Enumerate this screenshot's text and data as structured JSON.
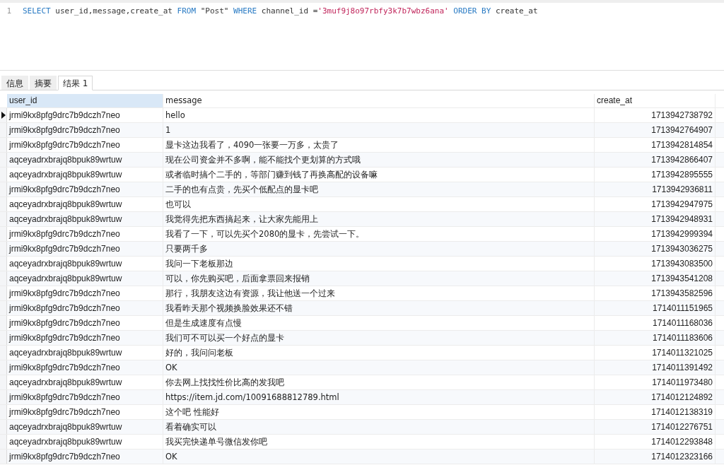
{
  "editor": {
    "line_number": "1",
    "tokens": [
      {
        "kind": "keyword",
        "text": "SELECT"
      },
      {
        "kind": "plain",
        "text": " user_id,message,create_at "
      },
      {
        "kind": "keyword",
        "text": "FROM"
      },
      {
        "kind": "plain",
        "text": " \"Post\" "
      },
      {
        "kind": "keyword",
        "text": "WHERE"
      },
      {
        "kind": "plain",
        "text": " channel_id ="
      },
      {
        "kind": "string",
        "text": "'3muf9j8o97rbfy3k7b7wbz6ana'"
      },
      {
        "kind": "keyword",
        "text": " ORDER BY"
      },
      {
        "kind": "plain",
        "text": " create_at"
      }
    ]
  },
  "tabs": [
    {
      "label": "信息",
      "selected": false
    },
    {
      "label": "摘要",
      "selected": false
    },
    {
      "label": "结果 1",
      "selected": true
    }
  ],
  "table": {
    "columns": [
      {
        "label": "user_id",
        "selected": true
      },
      {
        "label": "message",
        "selected": false
      },
      {
        "label": "create_at",
        "selected": false
      }
    ],
    "rows": [
      {
        "selected": true,
        "cells": [
          "jrmi9kx8pfg9drc7b9dczh7neo",
          "hello",
          "1713942738792"
        ]
      },
      {
        "selected": false,
        "cells": [
          "jrmi9kx8pfg9drc7b9dczh7neo",
          "1",
          "1713942764907"
        ]
      },
      {
        "selected": false,
        "cells": [
          "jrmi9kx8pfg9drc7b9dczh7neo",
          "显卡这边我看了，4090一张要一万多，太贵了",
          "1713942814854"
        ]
      },
      {
        "selected": false,
        "cells": [
          "aqceyadrxbrajq8bpuk89wrtuw",
          "现在公司资金并不多啊，能不能找个更划算的方式哦",
          "1713942866407"
        ]
      },
      {
        "selected": false,
        "cells": [
          "aqceyadrxbrajq8bpuk89wrtuw",
          "或者临时搞个二手的，等部门赚到钱了再换高配的设备嘛",
          "1713942895555"
        ]
      },
      {
        "selected": false,
        "cells": [
          "jrmi9kx8pfg9drc7b9dczh7neo",
          "二手的也有点贵，先买个低配点的显卡吧",
          "1713942936811"
        ]
      },
      {
        "selected": false,
        "cells": [
          "aqceyadrxbrajq8bpuk89wrtuw",
          "也可以",
          "1713942947975"
        ]
      },
      {
        "selected": false,
        "cells": [
          "aqceyadrxbrajq8bpuk89wrtuw",
          "我觉得先把东西搞起来，让大家先能用上",
          "1713942948931"
        ]
      },
      {
        "selected": false,
        "cells": [
          "jrmi9kx8pfg9drc7b9dczh7neo",
          "我看了一下，可以先买个2080的显卡，先尝试一下。",
          "1713942999394"
        ]
      },
      {
        "selected": false,
        "cells": [
          "jrmi9kx8pfg9drc7b9dczh7neo",
          "只要两千多",
          "1713943036275"
        ]
      },
      {
        "selected": false,
        "cells": [
          "aqceyadrxbrajq8bpuk89wrtuw",
          "我问一下老板那边",
          "1713943083500"
        ]
      },
      {
        "selected": false,
        "cells": [
          "aqceyadrxbrajq8bpuk89wrtuw",
          "可以，你先购买吧，后面拿票回来报销",
          "1713943541208"
        ]
      },
      {
        "selected": false,
        "cells": [
          "jrmi9kx8pfg9drc7b9dczh7neo",
          "那行，我朋友这边有资源，我让他送一个过来",
          "1713943582596"
        ]
      },
      {
        "selected": false,
        "cells": [
          "jrmi9kx8pfg9drc7b9dczh7neo",
          "我看昨天那个视频换脸效果还不错",
          "1714011151965"
        ]
      },
      {
        "selected": false,
        "cells": [
          "jrmi9kx8pfg9drc7b9dczh7neo",
          "但是生成速度有点慢",
          "1714011168036"
        ]
      },
      {
        "selected": false,
        "cells": [
          "jrmi9kx8pfg9drc7b9dczh7neo",
          "我们可不可以买一个好点的显卡",
          "1714011183606"
        ]
      },
      {
        "selected": false,
        "cells": [
          "aqceyadrxbrajq8bpuk89wrtuw",
          "好的，我问问老板",
          "1714011321025"
        ]
      },
      {
        "selected": false,
        "cells": [
          "jrmi9kx8pfg9drc7b9dczh7neo",
          "OK",
          "1714011391492"
        ]
      },
      {
        "selected": false,
        "cells": [
          "aqceyadrxbrajq8bpuk89wrtuw",
          "你去网上找找性价比高的发我吧",
          "1714011973480"
        ]
      },
      {
        "selected": false,
        "cells": [
          "jrmi9kx8pfg9drc7b9dczh7neo",
          "https://item.jd.com/10091688812789.html",
          "1714012124892"
        ]
      },
      {
        "selected": false,
        "cells": [
          "jrmi9kx8pfg9drc7b9dczh7neo",
          "这个吧 性能好",
          "1714012138319"
        ]
      },
      {
        "selected": false,
        "cells": [
          "aqceyadrxbrajq8bpuk89wrtuw",
          "看着确实可以",
          "1714012276751"
        ]
      },
      {
        "selected": false,
        "cells": [
          "aqceyadrxbrajq8bpuk89wrtuw",
          "我买完快递单号微信发你吧",
          "1714012293848"
        ]
      },
      {
        "selected": false,
        "cells": [
          "jrmi9kx8pfg9drc7b9dczh7neo",
          "OK",
          "1714012323166"
        ]
      }
    ]
  }
}
